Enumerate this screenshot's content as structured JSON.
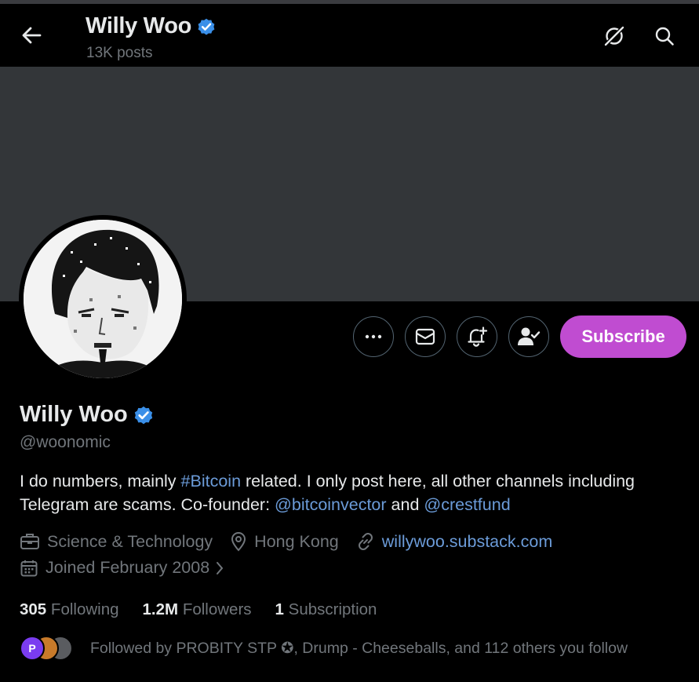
{
  "header": {
    "name": "Willy Woo",
    "posts": "13K posts"
  },
  "actions": {
    "subscribe_label": "Subscribe"
  },
  "profile": {
    "name": "Willy Woo",
    "handle": "@woonomic",
    "bio": {
      "t1": "I do numbers, mainly ",
      "hashtag": "#Bitcoin",
      "t2": " related. I only post here, all other channels including Telegram are scams. Co-founder: ",
      "mention1": "@bitcoinvector",
      "t3": " and ",
      "mention2": "@crestfund"
    },
    "category": "Science & Technology",
    "location": "Hong Kong",
    "website": "willywoo.substack.com",
    "joined": "Joined February 2008"
  },
  "stats": {
    "following_count": "305",
    "following_label": "Following",
    "followers_count": "1.2M",
    "followers_label": "Followers",
    "subscription_count": "1",
    "subscription_label": "Subscription"
  },
  "followed_by": "Followed by PROBITY STP ✪, Drump - Cheeseballs, and 112 others you follow",
  "colors": {
    "background": "#000000",
    "banner": "#333639",
    "link": "#6b9bd8",
    "verified": "#3a8fe8",
    "subscribe": "#c04cd1",
    "muted": "#71767b"
  },
  "icons": [
    "back-arrow-icon",
    "grok-icon",
    "search-icon",
    "more-icon",
    "mail-icon",
    "bell-plus-icon",
    "person-check-icon",
    "verified-badge-icon",
    "briefcase-icon",
    "location-pin-icon",
    "link-icon",
    "calendar-icon",
    "chevron-right-icon"
  ]
}
